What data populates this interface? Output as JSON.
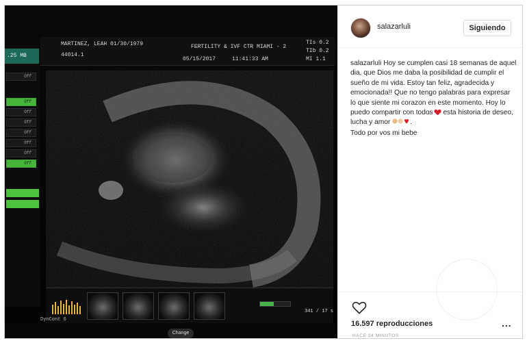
{
  "ultrasound": {
    "patient": "MARTINEZ, LEAH  01/30/1979",
    "patient_id": "44014.1",
    "clinic": "FERTILITY & IVF CTR MIAMI - 2",
    "date": "05/15/2017",
    "time": "11:41:33 AM",
    "tis": "TIs  0.2",
    "tib": "TIb  0.2",
    "mi": "MI  1.1",
    "file_size": ".25 MB",
    "side_buttons": [
      "Off",
      "Off",
      "Off",
      "Off",
      "Off",
      "Off",
      "Off",
      "Off"
    ],
    "dyncont": "DynCont 6",
    "change": "Change",
    "frame_counter": "341 / 17 s",
    "progress_fraction": 0.45
  },
  "post": {
    "username": "salazarluli",
    "follow_label": "Siguiendo",
    "caption_user": "salazarluli",
    "caption_text_1": "Hoy se cumplen casi 18 semanas de aquel dia, que Dios me daba la posibilidad de cumplir el sueño de mi vida. Estoy tan feliz, agradecida y emocionada!! Que no tengo palabras para expresar lo que siente mi corazon en este momento. Hoy lo puedo compartir con todos",
    "caption_text_2": "esta historia de deseo, lucha y amor",
    "caption_text_3": "Todo por vos mi bebe",
    "views": "16.597 reproducciones",
    "timestamp": "HACE 34 MINUTOS",
    "more_label": "..."
  },
  "icons": {
    "like": "heart-outline-icon",
    "more": "more-options-icon",
    "heart_emoji": "red-heart-icon"
  },
  "colors": {
    "accent_green": "#47b53c",
    "heart_red": "#d11d2c",
    "text": "#262626"
  }
}
